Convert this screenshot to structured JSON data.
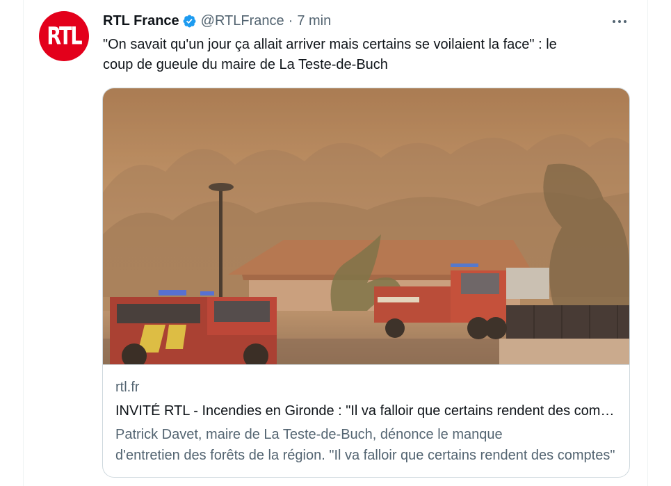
{
  "tweet": {
    "author": {
      "display_name": "RTL France",
      "handle": "@RTLFrance",
      "verified": true,
      "avatar_text": "RTL",
      "avatar_color": "#e3001b"
    },
    "separator": "·",
    "time": "7 min",
    "text_line_1": "\"On savait qu'un jour ça allait arriver mais certains se voilaient la face\" : le",
    "text_line_2": "coup de gueule du maire de La Teste-de-Buch",
    "more_icon": "more-horizontal-icon",
    "verified_icon": "verified-badge-icon",
    "verified_color": "#1d9bf0"
  },
  "card": {
    "image_alt": "Camions de pompiers devant une maison dans la fumée d'un incendie",
    "domain": "rtl.fr",
    "title": "INVITÉ RTL - Incendies en Gironde : \"Il va falloir que certains rendent des comptes\"",
    "description_line_1": "Patrick Davet, maire de La Teste-de-Buch, dénonce le manque",
    "description_line_2": "d'entretien des forêts de la région. \"Il va falloir que certains rendent des comptes\""
  },
  "colors": {
    "text_primary": "#0f1419",
    "text_secondary": "#536471",
    "border": "#cfd9de"
  }
}
